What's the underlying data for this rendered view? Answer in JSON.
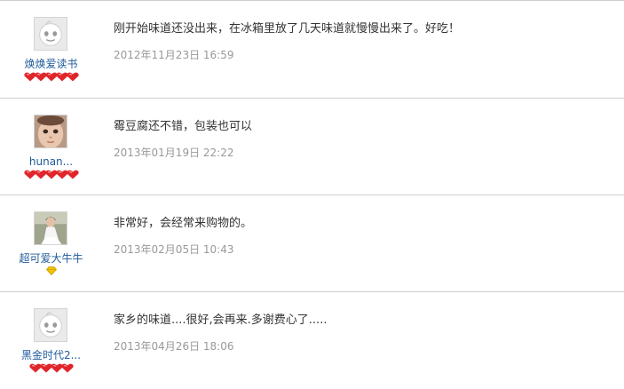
{
  "reviews": [
    {
      "username": "焕焕爱读书",
      "avatar": "default-face-icon",
      "comment": "刚开始味道还没出来，在冰箱里放了几天味道就慢慢出来了。好吃！",
      "date": "2012年11月23日 16:59",
      "rank_badge": "red-heart-icon",
      "rank_count": 5
    },
    {
      "username": "hunan...",
      "avatar": "baby-photo-icon",
      "comment": "霉豆腐还不错，包装也可以",
      "date": "2013年01月19日 22:22",
      "rank_badge": "red-heart-icon",
      "rank_count": 5
    },
    {
      "username": "超可爱大牛牛",
      "avatar": "bride-photo-icon",
      "comment": "非常好，会经常来购物的。",
      "date": "2013年02月05日 10:43",
      "rank_badge": "yellow-diamond-icon",
      "rank_count": 1
    },
    {
      "username": "黑金时代2...",
      "avatar": "default-face-icon",
      "comment": "家乡的味道....很好,会再来.多谢费心了.....",
      "date": "2013年04月26日 18:06",
      "rank_badge": "red-heart-icon",
      "rank_count": 4
    }
  ],
  "colors": {
    "username": "#1f5a9a",
    "date": "#999999",
    "comment": "#333333",
    "divider": "#cfcfcf",
    "heart_badge": "#e0262b",
    "diamond_badge": "#f2c200"
  }
}
